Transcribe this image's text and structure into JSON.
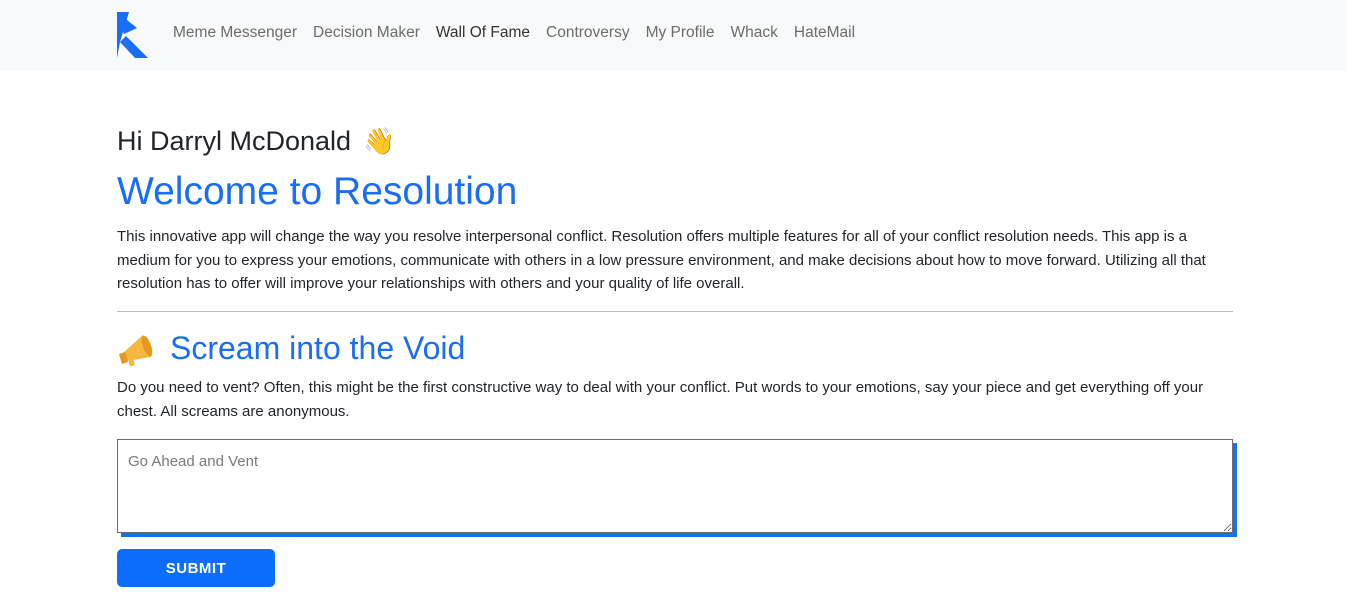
{
  "nav": {
    "logo_icon": "resolution-logo-icon",
    "links": [
      {
        "label": "Meme Messenger",
        "active": false
      },
      {
        "label": "Decision Maker",
        "active": false
      },
      {
        "label": "Wall Of Fame",
        "active": true
      },
      {
        "label": "Controversy",
        "active": false
      },
      {
        "label": "My Profile",
        "active": false
      },
      {
        "label": "Whack",
        "active": false
      },
      {
        "label": "HateMail",
        "active": false
      }
    ]
  },
  "main": {
    "greeting": "Hi Darryl McDonald",
    "greeting_emoji": "👋",
    "welcome_title": "Welcome to Resolution",
    "intro_text": "This innovative app will change the way you resolve interpersonal conflict. Resolution offers multiple features for all of your conflict resolution needs. This app is a medium for you to express your emotions, communicate with others in a low pressure environment, and make decisions about how to move forward. Utilizing all that resolution has to offer will improve your relationships with others and your quality of life overall.",
    "scream_icon": "megaphone-icon",
    "scream_title": "Scream into the Void",
    "scream_desc": "Do you need to vent? Often, this might be the first constructive way to deal with your conflict. Put words to your emotions, say your piece and get everything off your chest. All screams are anonymous.",
    "vent_placeholder": "Go Ahead and Vent",
    "vent_value": "",
    "submit_label": "SUBMIT"
  },
  "colors": {
    "accent": "#1a6ef5",
    "button": "#0d6efd",
    "navbar_bg": "#f8f9fa",
    "megaphone": "#f4b73f"
  }
}
